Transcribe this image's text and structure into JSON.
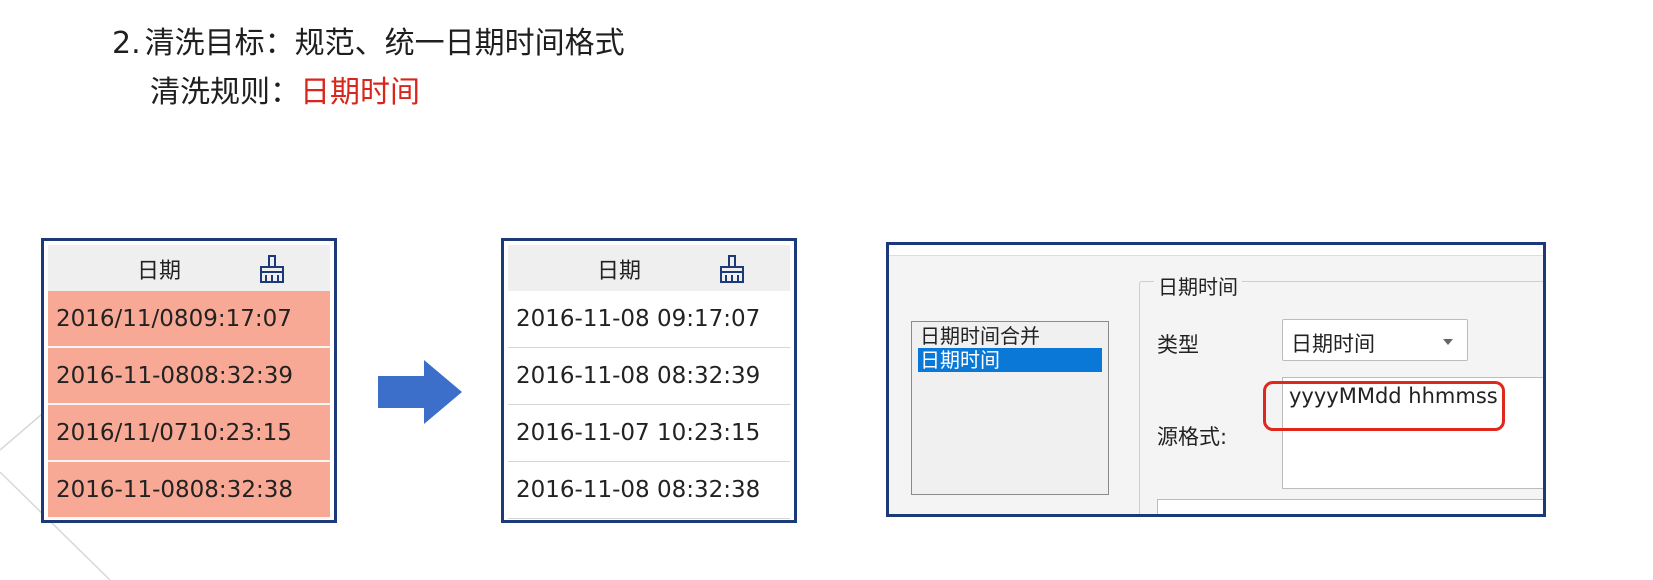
{
  "heading": {
    "number": "2.",
    "text": "清洗目标：规范、统一日期时间格式"
  },
  "rule": {
    "label": "清洗规则：",
    "value": "日期时间",
    "value_color": "#d8261c"
  },
  "before_table": {
    "header": "日期",
    "rows": [
      "2016/11/0809:17:07",
      "2016-11-0808:32:39",
      "2016/11/0710:23:15",
      "2016-11-0808:32:38"
    ],
    "row_color": "#f7a996"
  },
  "after_table": {
    "header": "日期",
    "rows": [
      "2016-11-08 09:17:07",
      "2016-11-08 08:32:39",
      "2016-11-07 10:23:15",
      "2016-11-08 08:32:38"
    ]
  },
  "config_panel": {
    "list_items": [
      {
        "label": "日期时间合并",
        "selected": false
      },
      {
        "label": "日期时间",
        "selected": true
      }
    ],
    "group_title": "日期时间",
    "type_label": "类型",
    "type_value": "日期时间",
    "source_format_label": "源格式:",
    "source_format_value": "yyyyMMdd hhmmss"
  },
  "colors": {
    "frame_border": "#1c3a78",
    "arrow": "#3c6fc9",
    "highlight_box": "#e0271c",
    "selection": "#0a78d7"
  },
  "icons": [
    "broom-icon",
    "right-arrow-icon",
    "chevron-down-icon"
  ]
}
